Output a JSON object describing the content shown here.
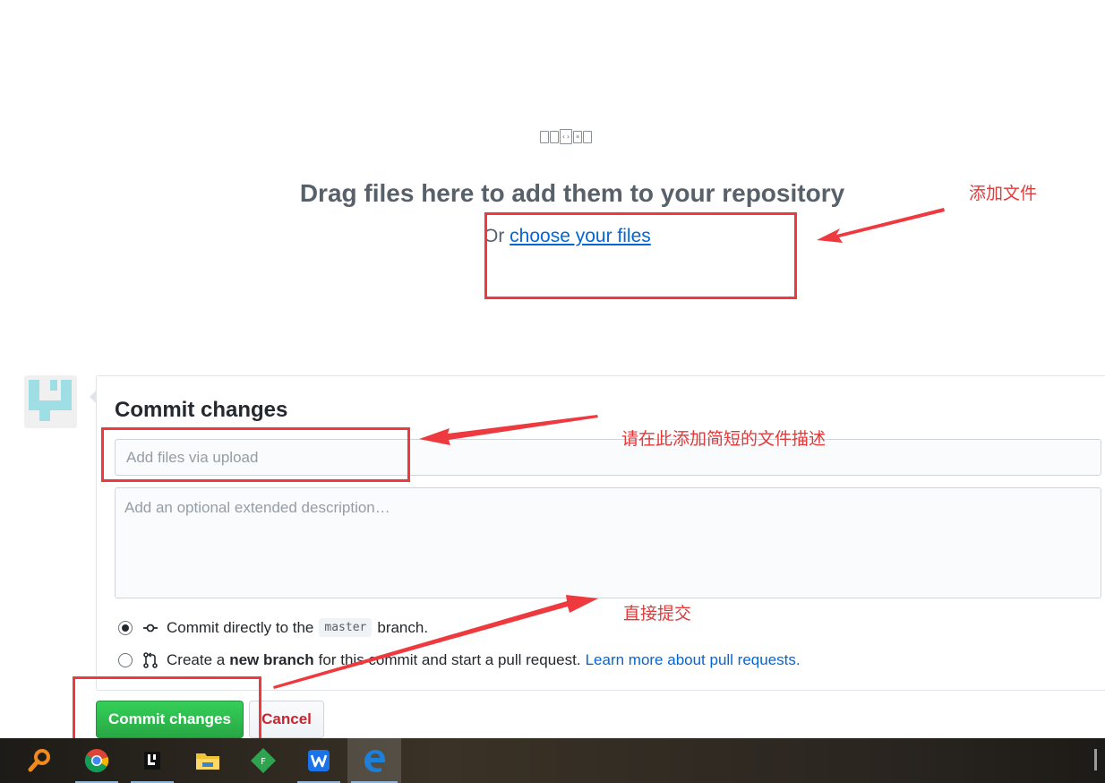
{
  "upload": {
    "title": "Drag files here to add them to your repository",
    "or_text": "Or",
    "choose_link": "choose your files"
  },
  "commit": {
    "heading": "Commit changes",
    "summary_placeholder": "Add files via upload",
    "description_placeholder": "Add an optional extended description…",
    "option_direct": {
      "prefix": "Commit directly to the",
      "branch": "master",
      "suffix": "branch."
    },
    "option_new": {
      "prefix": "Create a",
      "bold": "new branch",
      "suffix": "for this commit and start a pull request.",
      "link": "Learn more about pull requests."
    },
    "commit_button": "Commit changes",
    "cancel_button": "Cancel"
  },
  "annotations": {
    "add_files": "添加文件",
    "describe": "请在此添加简短的文件描述",
    "submit": "直接提交",
    "color": "#ee3a3f"
  },
  "taskbar": {
    "icons": [
      "search-icon",
      "chrome-icon",
      "app-l-icon",
      "file-explorer-icon",
      "green-diamond-app-icon",
      "wps-icon",
      "edge-icon"
    ],
    "active": "edge-icon"
  }
}
